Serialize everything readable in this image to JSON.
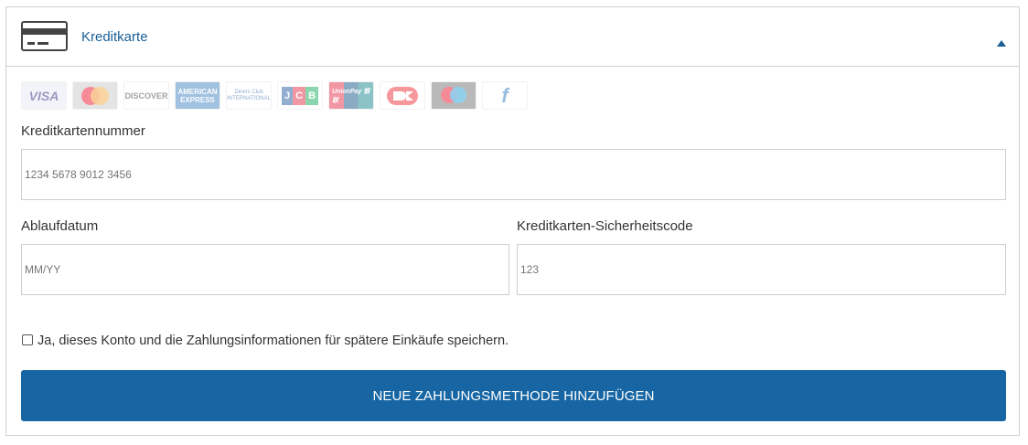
{
  "header": {
    "title": "Kreditkarte",
    "icon": "credit-card-icon",
    "toggle_icon": "chevron-up-icon"
  },
  "logos": [
    {
      "name": "visa",
      "text": "VISA"
    },
    {
      "name": "mastercard",
      "text": ""
    },
    {
      "name": "discover",
      "text": "DISCOVER"
    },
    {
      "name": "american-express",
      "text": "AMERICAN EXPRESS"
    },
    {
      "name": "diners-club",
      "text": "Diners Club INTERNATIONAL"
    },
    {
      "name": "jcb",
      "text": "JCB"
    },
    {
      "name": "unionpay",
      "text": "UnionPay 银联"
    },
    {
      "name": "dankort",
      "text": ""
    },
    {
      "name": "maestro",
      "text": ""
    },
    {
      "name": "forbrugsforeningen",
      "text": "f"
    }
  ],
  "form": {
    "card_number": {
      "label": "Kreditkartennummer",
      "placeholder": "1234 5678 9012 3456"
    },
    "expiry": {
      "label": "Ablaufdatum",
      "placeholder": "MM/YY"
    },
    "cvc": {
      "label": "Kreditkarten-Sicherheitscode",
      "placeholder": "123"
    },
    "save_checkbox": {
      "label": "Ja, dieses Konto und die Zahlungsinformationen für spätere Einkäufe speichern.",
      "checked": false
    },
    "submit_label": "NEUE ZAHLUNGSMETHODE HINZUFÜGEN"
  },
  "colors": {
    "accent": "#1766a3",
    "title": "#1a5f96",
    "border": "#cfcfcf"
  }
}
